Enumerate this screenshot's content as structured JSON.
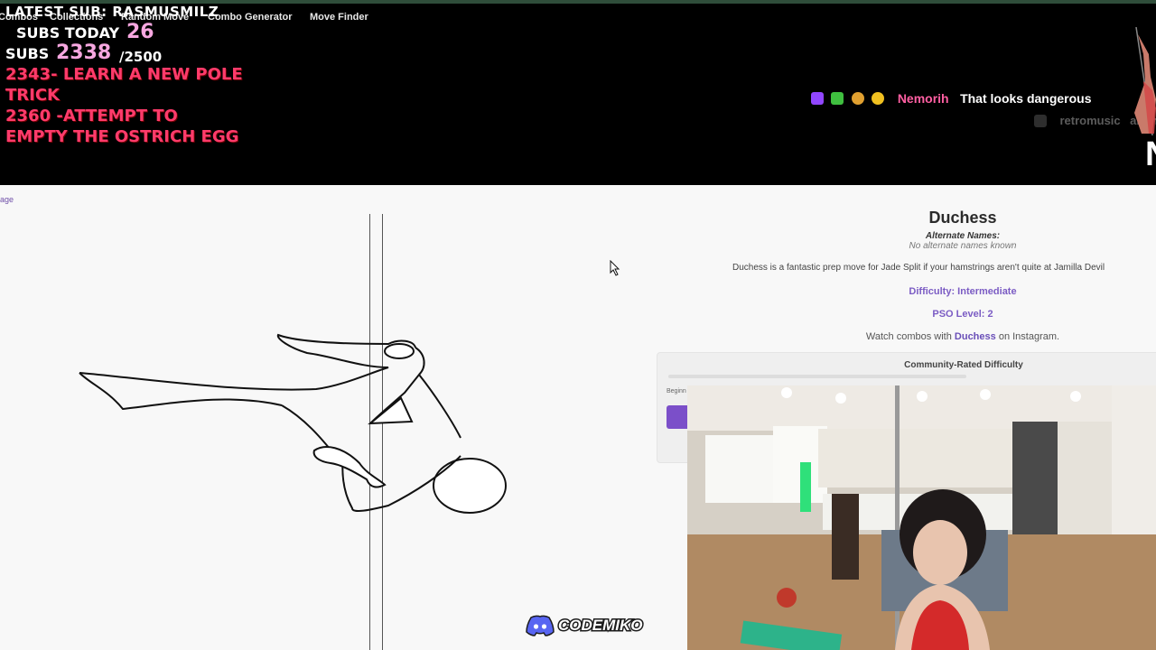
{
  "nav": {
    "items": [
      "Combos",
      "Collections",
      "Random Move",
      "Combo Generator",
      "Move Finder"
    ]
  },
  "overlay": {
    "latest_sub": "LATEST SUB: RASMUSMILZ",
    "subs_today_label": "SUBS TODAY",
    "subs_today_value": "26",
    "subs_label": "SUBS",
    "subs_value": "2338",
    "subs_goal": "/2500",
    "goals": [
      "2343- LEARN A NEW POLE",
      "TRICK",
      "2360 -ATTEMPT TO",
      "EMPTY THE OSTRICH EGG"
    ]
  },
  "chat": {
    "messages": [
      {
        "user": "Nemorih",
        "text": "That looks dangerous"
      },
      {
        "user": "retromusic",
        "text": "ah th"
      }
    ],
    "badge_colors": [
      "#9146ff",
      "#3fbf3f",
      "#e0a030",
      "#f0c020"
    ]
  },
  "site": {
    "crumb": "age",
    "move": {
      "title": "Duchess",
      "alt_names_label": "Alternate Names:",
      "alt_names_value": "No alternate names known",
      "description": "Duchess is a fantastic prep move for Jade Split if your hamstrings aren't quite at Jamilla Devil",
      "difficulty": "Difficulty: Intermediate",
      "pso_level": "PSO Level: 2",
      "watch_prefix": "Watch combos with ",
      "watch_move": "Duchess",
      "watch_suffix": " on Instagram."
    },
    "community": {
      "title": "Community-Rated Difficulty",
      "scale_start": "Beginn"
    }
  },
  "discord": {
    "label": "CODEMIKO",
    "icon": "discord-icon"
  },
  "misc": {
    "edge_letter": "N"
  },
  "colors": {
    "accent_purple": "#7b5cc4",
    "overlay_pink": "#f7a7e0",
    "goal_red": "#ff3b6b",
    "chat_pink": "#ff5fa2"
  }
}
